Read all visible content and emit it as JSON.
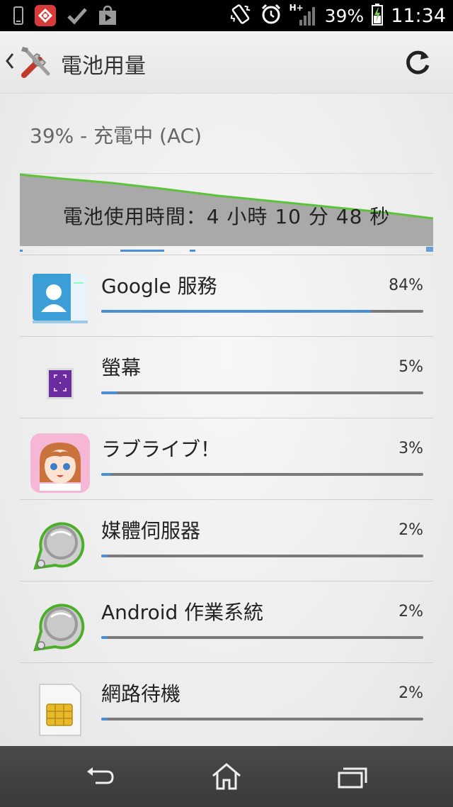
{
  "status_bar": {
    "network_label": "H+",
    "battery_percent": "39%",
    "time": "11:34"
  },
  "header": {
    "title": "電池用量"
  },
  "summary": {
    "status": "39% - 充電中 (AC)",
    "usage_time": "電池使用時間：4 小時 10 分 48 秒"
  },
  "items": [
    {
      "label": "Google 服務",
      "percent": "84%",
      "fraction": 0.84,
      "icon": "google-services-icon"
    },
    {
      "label": "螢幕",
      "percent": "5%",
      "fraction": 0.05,
      "icon": "screen-icon"
    },
    {
      "label": "ラブライブ！",
      "percent": "3%",
      "fraction": 0.03,
      "icon": "lovelive-app-icon"
    },
    {
      "label": "媒體伺服器",
      "percent": "2%",
      "fraction": 0.02,
      "icon": "media-server-icon"
    },
    {
      "label": "Android 作業系統",
      "percent": "2%",
      "fraction": 0.02,
      "icon": "android-os-icon"
    },
    {
      "label": "網路待機",
      "percent": "2%",
      "fraction": 0.02,
      "icon": "sim-card-icon"
    }
  ],
  "colors": {
    "bar_fill": "#4a8fd6",
    "graph_line": "#5cc33a",
    "graph_fill": "#a9a9a9"
  }
}
